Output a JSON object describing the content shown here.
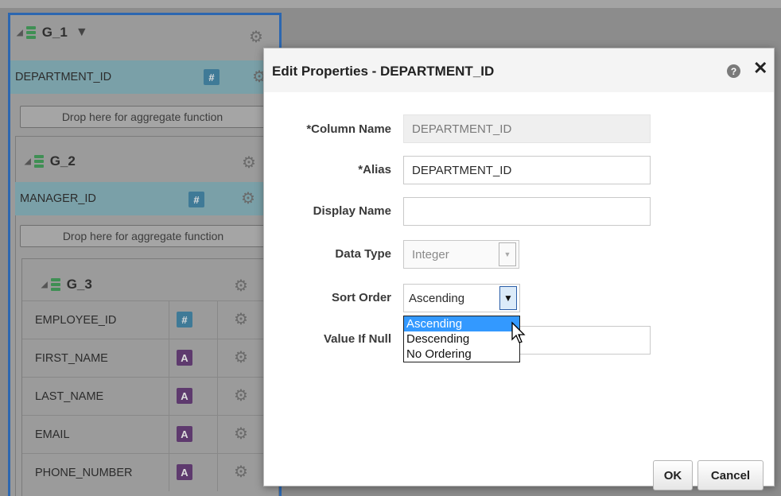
{
  "model": {
    "g1": {
      "name": "G_1",
      "column": "DEPARTMENT_ID",
      "drop_text": "Drop here for aggregate function"
    },
    "g2": {
      "name": "G_2",
      "column": "MANAGER_ID",
      "drop_text": "Drop here for aggregate function"
    },
    "g3": {
      "name": "G_3",
      "columns": [
        {
          "name": "EMPLOYEE_ID",
          "badge": "#"
        },
        {
          "name": "FIRST_NAME",
          "badge": "A"
        },
        {
          "name": "LAST_NAME",
          "badge": "A"
        },
        {
          "name": "EMAIL",
          "badge": "A"
        },
        {
          "name": "PHONE_NUMBER",
          "badge": "A"
        }
      ]
    },
    "num_badge": "#",
    "str_badge": "A"
  },
  "dialog": {
    "title": "Edit Properties - DEPARTMENT_ID",
    "help": "?",
    "close": "✕",
    "fields": {
      "column_name": {
        "label": "*Column Name",
        "value": "DEPARTMENT_ID"
      },
      "alias": {
        "label": "*Alias",
        "value": "DEPARTMENT_ID"
      },
      "display_name": {
        "label": "Display Name",
        "value": ""
      },
      "data_type": {
        "label": "Data Type",
        "value": "Integer"
      },
      "sort_order": {
        "label": "Sort Order",
        "value": "Ascending"
      },
      "value_if_null": {
        "label": "Value If Null",
        "value": ""
      }
    },
    "sort_options": [
      "Ascending",
      "Descending",
      "No Ordering"
    ],
    "ok_label": "OK",
    "cancel_label": "Cancel"
  },
  "colors": {
    "accent": "#2c67b0",
    "dropdown_highlight": "#3399ff"
  },
  "icons": {
    "gear": "gear-icon",
    "database": "database-icon",
    "filter": "filter-icon"
  }
}
